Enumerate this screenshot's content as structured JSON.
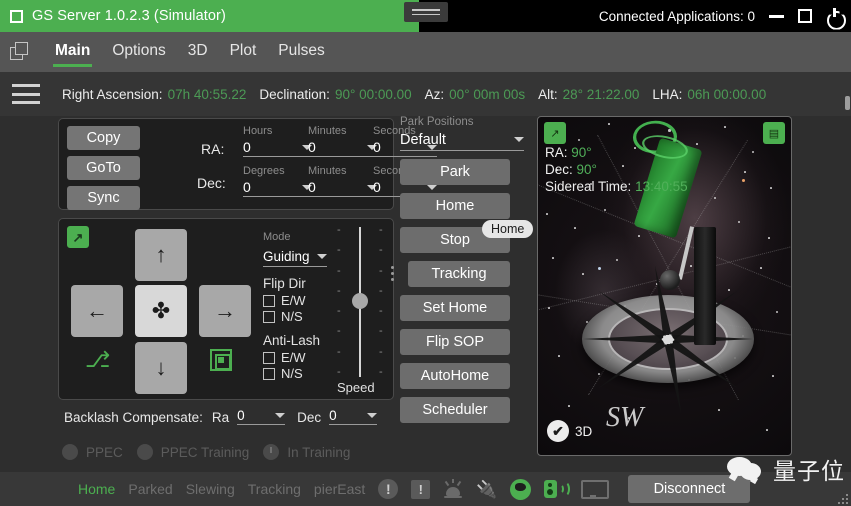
{
  "window": {
    "title": "GS Server 1.0.2.3 (Simulator)",
    "connected_applications_label": "Connected Applications: 0",
    "accent_green": "#4caf50",
    "title_bg": "#4caf50"
  },
  "menu": {
    "items": [
      {
        "label": "Main",
        "active": true
      },
      {
        "label": "Options",
        "active": false
      },
      {
        "label": "3D",
        "active": false
      },
      {
        "label": "Plot",
        "active": false
      },
      {
        "label": "Pulses",
        "active": false
      }
    ]
  },
  "coordbar": {
    "items": [
      {
        "label": "Right Ascension:",
        "value": "07h 40:55.22"
      },
      {
        "label": "Declination:",
        "value": "90° 00:00.00"
      },
      {
        "label": "Az:",
        "value": "00° 00m 00s"
      },
      {
        "label": "Alt:",
        "value": "28° 21:22.00"
      },
      {
        "label": "LHA:",
        "value": "06h 00:00.00"
      }
    ]
  },
  "coord_panel": {
    "buttons": [
      {
        "label": "Copy"
      },
      {
        "label": "GoTo"
      },
      {
        "label": "Sync"
      }
    ],
    "ra_label": "RA:",
    "dec_label": "Dec:",
    "ra_fields": [
      {
        "caption": "Hours",
        "value": "0"
      },
      {
        "caption": "Minutes",
        "value": "0"
      },
      {
        "caption": "Seconds",
        "value": "0"
      }
    ],
    "dec_fields": [
      {
        "caption": "Degrees",
        "value": "0"
      },
      {
        "caption": "Minutes",
        "value": "0"
      },
      {
        "caption": "Seconds",
        "value": "0"
      }
    ]
  },
  "pad_panel": {
    "up": "↑",
    "down": "↓",
    "left": "←",
    "right": "→",
    "center": "✤",
    "mode_caption": "Mode",
    "mode_value": "Guiding",
    "flip_dir_title": "Flip Dir",
    "flip_dir": [
      {
        "label": "E/W",
        "checked": false
      },
      {
        "label": "N/S",
        "checked": false
      }
    ],
    "anti_lash_title": "Anti-Lash",
    "anti_lash": [
      {
        "label": "E/W",
        "checked": false
      },
      {
        "label": "N/S",
        "checked": false
      }
    ],
    "speed_label": "Speed",
    "speed_ticks": [
      "-",
      "-",
      "-",
      "-",
      "-",
      "-",
      "-",
      "-"
    ]
  },
  "backlash": {
    "title": "Backlash Compensate:",
    "ra_label": "Ra",
    "ra_value": "0",
    "dec_label": "Dec",
    "dec_value": "0"
  },
  "ppec": {
    "ppec_label": "PPEC",
    "ppec_training_label": "PPEC Training",
    "in_training_label": "In Training"
  },
  "park": {
    "caption": "Park Positions",
    "selected": "Default",
    "buttons": [
      {
        "label": "Park"
      },
      {
        "label": "Home"
      },
      {
        "label": "Stop"
      },
      {
        "label": "Tracking"
      },
      {
        "label": "Set Home"
      },
      {
        "label": "Flip SOP"
      },
      {
        "label": "AutoHome"
      },
      {
        "label": "Scheduler"
      }
    ],
    "tooltip": "Home"
  },
  "sky": {
    "ra_key": "RA:",
    "ra_value": "90°",
    "dec_key": "Dec:",
    "dec_value": "90°",
    "sidereal_key": "Sidereal Time:",
    "sidereal_value": "13:40:55",
    "checkbox_3d_label": "3D",
    "checkbox_3d_mark": "✔",
    "watermark_sw": "SW"
  },
  "statusbar": {
    "words": [
      {
        "label": "Home",
        "state": "active"
      },
      {
        "label": "Parked",
        "state": "dim"
      },
      {
        "label": "Slewing",
        "state": "dim"
      },
      {
        "label": "Tracking",
        "state": "dim"
      },
      {
        "label": "pierEast",
        "state": "dim"
      }
    ],
    "warning_round": "!",
    "warning_square": "!",
    "disconnect_label": "Disconnect"
  },
  "watermark": {
    "text": "量子位"
  }
}
